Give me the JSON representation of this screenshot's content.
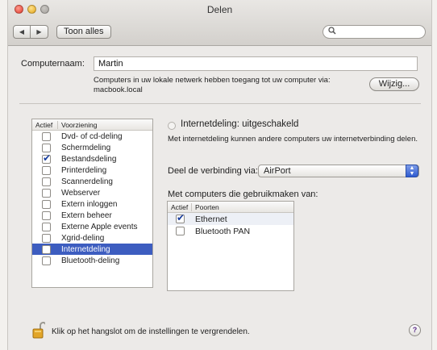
{
  "window": {
    "title": "Delen"
  },
  "toolbar": {
    "back_icon": "◀",
    "forward_icon": "▶",
    "show_all_label": "Toon alles",
    "search_icon": "search-icon",
    "search_placeholder": ""
  },
  "computer": {
    "name_label": "Computernaam:",
    "name_value": "Martin",
    "access_info_line1": "Computers in uw lokale netwerk hebben toegang tot uw computer via:",
    "access_info_line2": "macbook.local",
    "edit_button": "Wijzig..."
  },
  "services": {
    "header_active": "Actief",
    "header_service": "Voorziening",
    "items": [
      {
        "label": "Dvd- of cd-deling",
        "checked": false
      },
      {
        "label": "Schermdeling",
        "checked": false
      },
      {
        "label": "Bestandsdeling",
        "checked": true
      },
      {
        "label": "Printerdeling",
        "checked": false
      },
      {
        "label": "Scannerdeling",
        "checked": false
      },
      {
        "label": "Webserver",
        "checked": false
      },
      {
        "label": "Extern inloggen",
        "checked": false
      },
      {
        "label": "Extern beheer",
        "checked": false
      },
      {
        "label": "Externe Apple events",
        "checked": false
      },
      {
        "label": "Xgrid-deling",
        "checked": false
      },
      {
        "label": "Internetdeling",
        "checked": false,
        "selected": true
      },
      {
        "label": "Bluetooth-deling",
        "checked": false
      }
    ]
  },
  "detail": {
    "status": "Internetdeling: uitgeschakeld",
    "description": "Met internetdeling kunnen andere computers uw internetverbinding delen.",
    "share_via_label": "Deel de verbinding via:",
    "share_via_value": "AirPort",
    "computers_label": "Met computers die gebruikmaken van:",
    "ports_header_active": "Actief",
    "ports_header_ports": "Poorten",
    "ports": [
      {
        "label": "Ethernet",
        "checked": true
      },
      {
        "label": "Bluetooth PAN",
        "checked": false
      }
    ]
  },
  "footer": {
    "lock_text": "Klik op het hangslot om de instellingen te vergrendelen.",
    "help_label": "?"
  },
  "colors": {
    "selection": "#3d5dc0",
    "checkmark": "#173d9e",
    "window_bg": "#eceae8"
  }
}
